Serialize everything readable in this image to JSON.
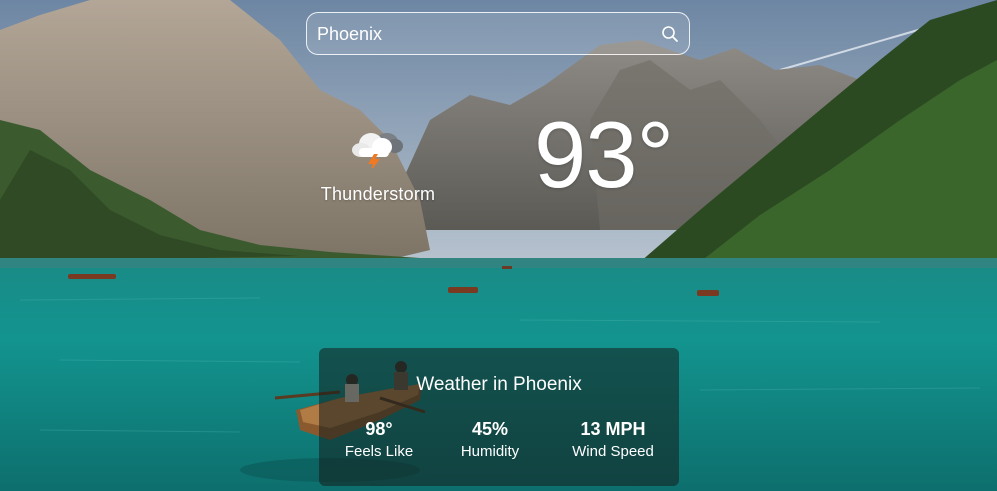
{
  "search": {
    "value": "Phoenix",
    "icon": "search-icon"
  },
  "current": {
    "condition": "Thunderstorm",
    "condition_icon": "thunderstorm-icon",
    "temperature": "93°"
  },
  "details": {
    "title": "Weather in Phoenix",
    "stats": [
      {
        "value": "98°",
        "label": "Feels Like"
      },
      {
        "value": "45%",
        "label": "Humidity"
      },
      {
        "value": "13 MPH",
        "label": "Wind Speed"
      }
    ]
  }
}
